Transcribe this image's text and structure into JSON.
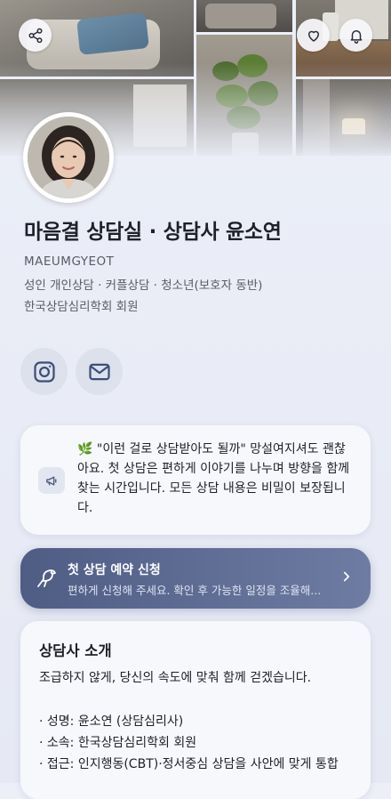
{
  "header": {
    "share_icon": "share-icon",
    "favorite_icon": "heart-icon",
    "notification_icon": "bell-icon"
  },
  "profile": {
    "name": "마음결 상담실 · 상담사 윤소연",
    "handle": "MAEUMGYEOT",
    "services": "성인 개인상담 · 커플상담 · 청소년(보호자 동반)",
    "affiliation": "한국상담심리학회 회원"
  },
  "social": {
    "instagram_icon": "instagram-icon",
    "email_icon": "mail-icon"
  },
  "notice": {
    "icon": "megaphone-icon",
    "text": "🌿 \"이런 걸로 상담받아도 될까\" 망설여지셔도 괜찮아요. 첫 상담은 편하게 이야기를 나누며 방향을 함께 찾는 시간입니다. 모든 상담 내용은 비밀이 보장됩니다."
  },
  "booking": {
    "icon": "bird-icon",
    "title": "첫 상담 예약 신청",
    "subtitle": "편하게 신청해 주세요. 확인 후 가능한 일정을 조율해...",
    "chevron": "chevron-right-icon"
  },
  "intro": {
    "title": "상담사 소개",
    "lead": "조급하지 않게, 당신의 속도에 맞춰 함께 걷겠습니다.",
    "items": [
      "· 성명: 윤소연 (상담심리사)",
      "· 소속: 한국상담심리학회 회원",
      "· 접근: 인지행동(CBT)·정서중심 상담을 사안에 맞게 통합"
    ]
  },
  "colors": {
    "background": "#eceff8",
    "card": "#f7f8fc",
    "booking_start": "#4f5d85",
    "booking_end": "#6e7ca3",
    "text_primary": "#1f2029",
    "text_secondary": "#595b66"
  }
}
